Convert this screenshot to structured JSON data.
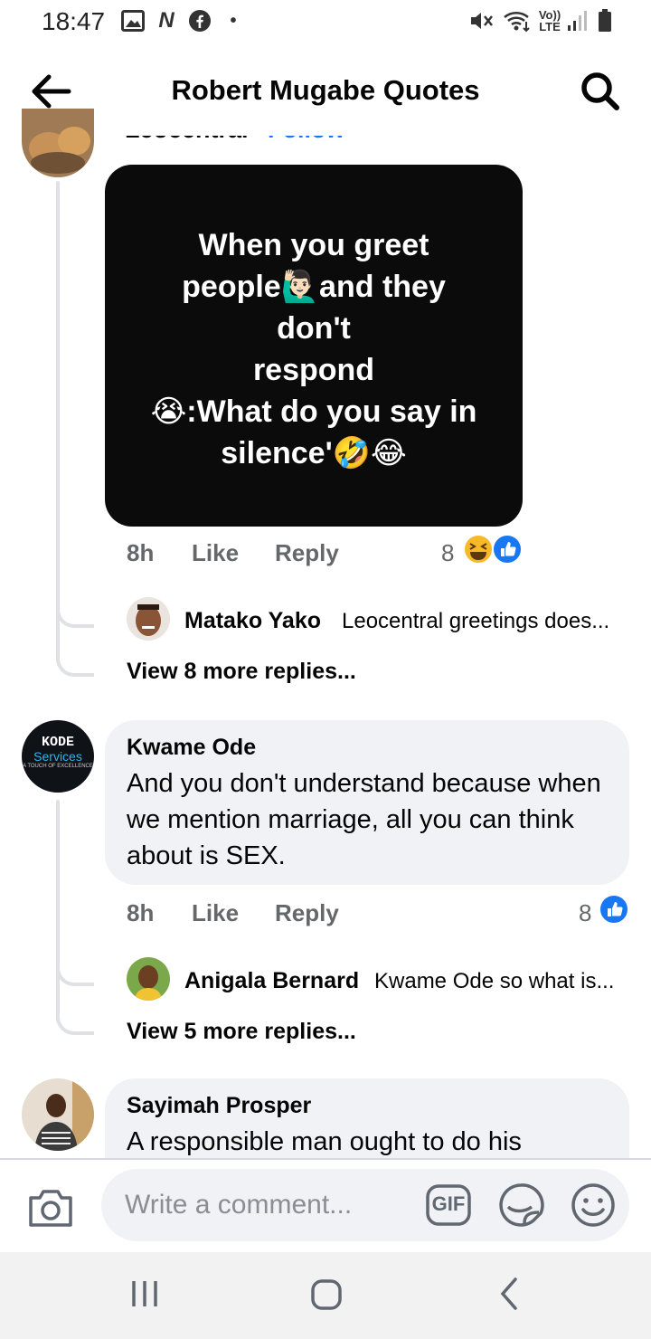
{
  "status_bar": {
    "time": "18:47",
    "voice_label_top": "Vo))",
    "voice_label_bottom": "LTE"
  },
  "header": {
    "title": "Robert Mugabe Quotes"
  },
  "thread_top": {
    "author_cut": "Leocentral",
    "follow_cut": "Follow",
    "meme_text": "When you greet\npeople🙋🏻‍♂️and they\ndon't\nrespond\n😭:What do you say in\nsilence'🤣😂",
    "time": "8h",
    "like": "Like",
    "reply": "Reply",
    "reaction_count": "8",
    "reactions": [
      "laughing-emoji",
      "like-icon"
    ],
    "reply_preview": {
      "name": "Matako Yako",
      "text": "Leocentral greetings does..."
    },
    "view_more": "View 8 more replies..."
  },
  "comment_kwame": {
    "name": "Kwame Ode",
    "text": "And you don't understand because when we mention marriage, all you can think about is SEX.",
    "avatar_text": {
      "brand": "KODE",
      "sub": "Services",
      "tagline": "A TOUCH OF EXCELLENCE"
    },
    "time": "8h",
    "like": "Like",
    "reply": "Reply",
    "reaction_count": "8",
    "reply_preview": {
      "name": "Anigala Bernard",
      "text": "Kwame Ode so what is..."
    },
    "view_more": "View 5 more replies..."
  },
  "comment_sayimah": {
    "name": "Sayimah Prosper",
    "text": "A responsible man ought to do his"
  },
  "composer": {
    "placeholder": "Write a comment...",
    "gif_label": "GIF"
  },
  "colors": {
    "like_blue": "#1877f2",
    "bubble": "#f0f2f5",
    "meme_bg": "#0b0b0b",
    "secondary_text": "#65676b"
  }
}
